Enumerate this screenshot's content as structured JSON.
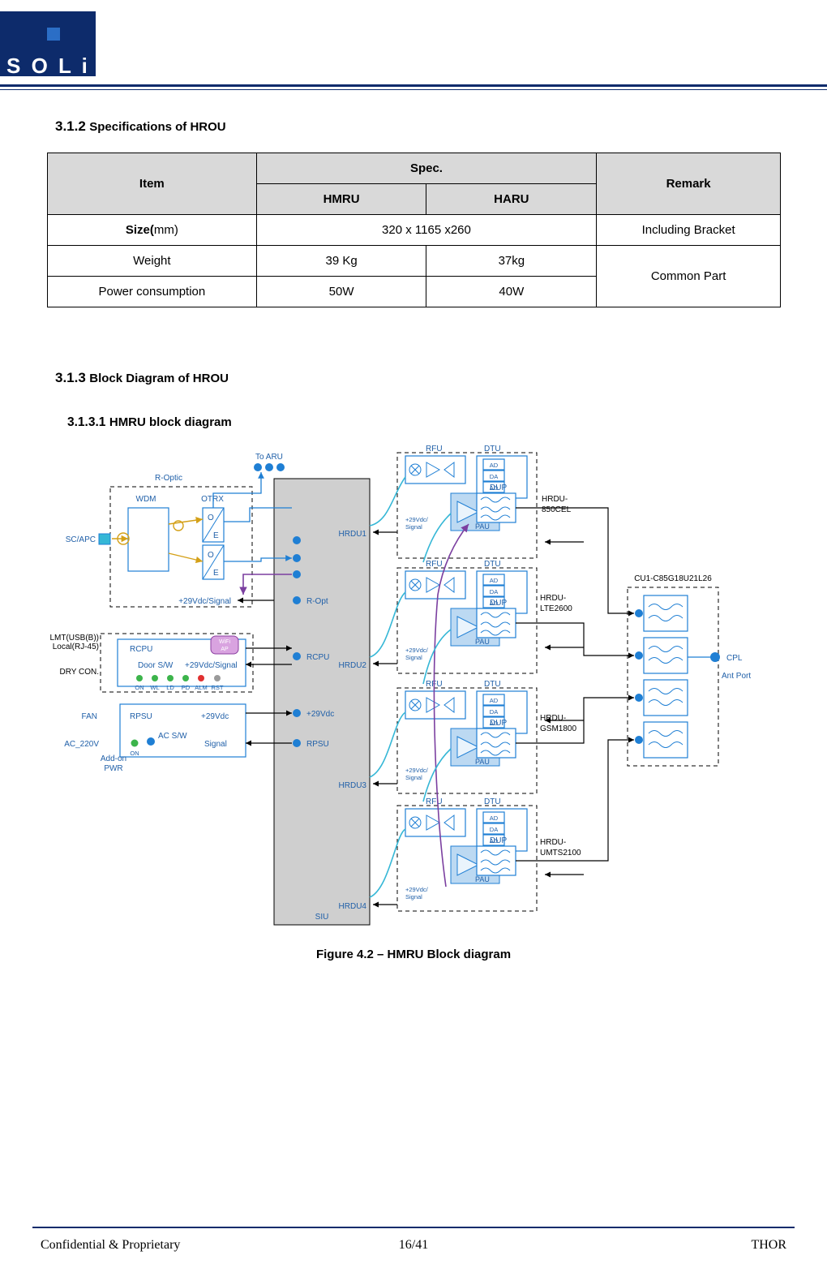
{
  "header": {
    "logo_text": "S O L i D"
  },
  "sections": {
    "spec": {
      "number": "3.1.2",
      "title": "Specifications of HROU"
    },
    "block": {
      "number": "3.1.3",
      "title": "Block Diagram of HROU"
    },
    "hmru": {
      "number": "3.1.3.1",
      "title": "HMRU block diagram"
    }
  },
  "spec_table": {
    "headers": {
      "item": "Item",
      "spec": "Spec.",
      "hmru": "HMRU",
      "haru": "HARU",
      "remark": "Remark"
    },
    "rows": [
      {
        "item_bold": "Size(",
        "item_light": "mm)",
        "value_span": "320 x 1165 x260",
        "remark": "Including Bracket"
      },
      {
        "item": "Weight",
        "hmru": "39 Kg",
        "haru": "37kg",
        "remark": "Common Part"
      },
      {
        "item": "Power consumption",
        "hmru": "50W",
        "haru": "40W"
      }
    ]
  },
  "figure": {
    "caption": "Figure 4.2 – HMRU Block diagram"
  },
  "diagram": {
    "labels": {
      "to_aru": "To ARU",
      "r_optic": "R-Optic",
      "wdm": "WDM",
      "otrx": "OTRX",
      "sc_apc": "SC/APC",
      "oe1_o": "O",
      "oe1_e": "E",
      "oe2_o": "O",
      "oe2_e": "E",
      "v29_signal_1": "+29Vdc/Signal",
      "r_opt": "R-Opt",
      "lmt": "LMT(USB(B))",
      "local": "Local(RJ-45)",
      "dry_con": "DRY CON.",
      "rcpu_box": "RCPU",
      "wifi_ap": "WiFi\nAP",
      "door_sw": "Door S/W",
      "v29_signal_2": "+29Vdc/Signal",
      "leds": [
        "ON",
        "WL",
        "LD",
        "PD",
        "ALM",
        "RST"
      ],
      "rcpu_line": "RCPU",
      "fan": "FAN",
      "rpsu_box": "RPSU",
      "v29vdc": "+29Vdc",
      "ac_220v": "AC_220V",
      "ac_sw": "AC S/W",
      "signal": "Signal",
      "on": "ON",
      "addon_pwr": "Add-on\nPWR",
      "v29vdc_line": "+29Vdc",
      "rpsu_line": "RPSU",
      "siu": "SIU",
      "hrdu1": "HRDU1",
      "hrdu2": "HRDU2",
      "hrdu3": "HRDU3",
      "hrdu4": "HRDU4",
      "rfu": "RFU",
      "dtu": "DTU",
      "ad": "AD",
      "da": "DA",
      "dup": "DUP",
      "pau": "PAU",
      "v29_sig_small": "+29Vdc/\nSignal",
      "hrdu_850": "HRDU-\n850CEL",
      "hrdu_lte": "HRDU-\nLTE2600",
      "hrdu_gsm": "HRDU-\nGSM1800",
      "hrdu_umts": "HRDU-\nUMTS2100",
      "cu_label": "CU1-C85G18U21L26",
      "cpl": "CPL",
      "ant_port": "Ant Port"
    }
  },
  "footer": {
    "left": "Confidential & Proprietary",
    "center": "16/41",
    "right": "THOR"
  }
}
